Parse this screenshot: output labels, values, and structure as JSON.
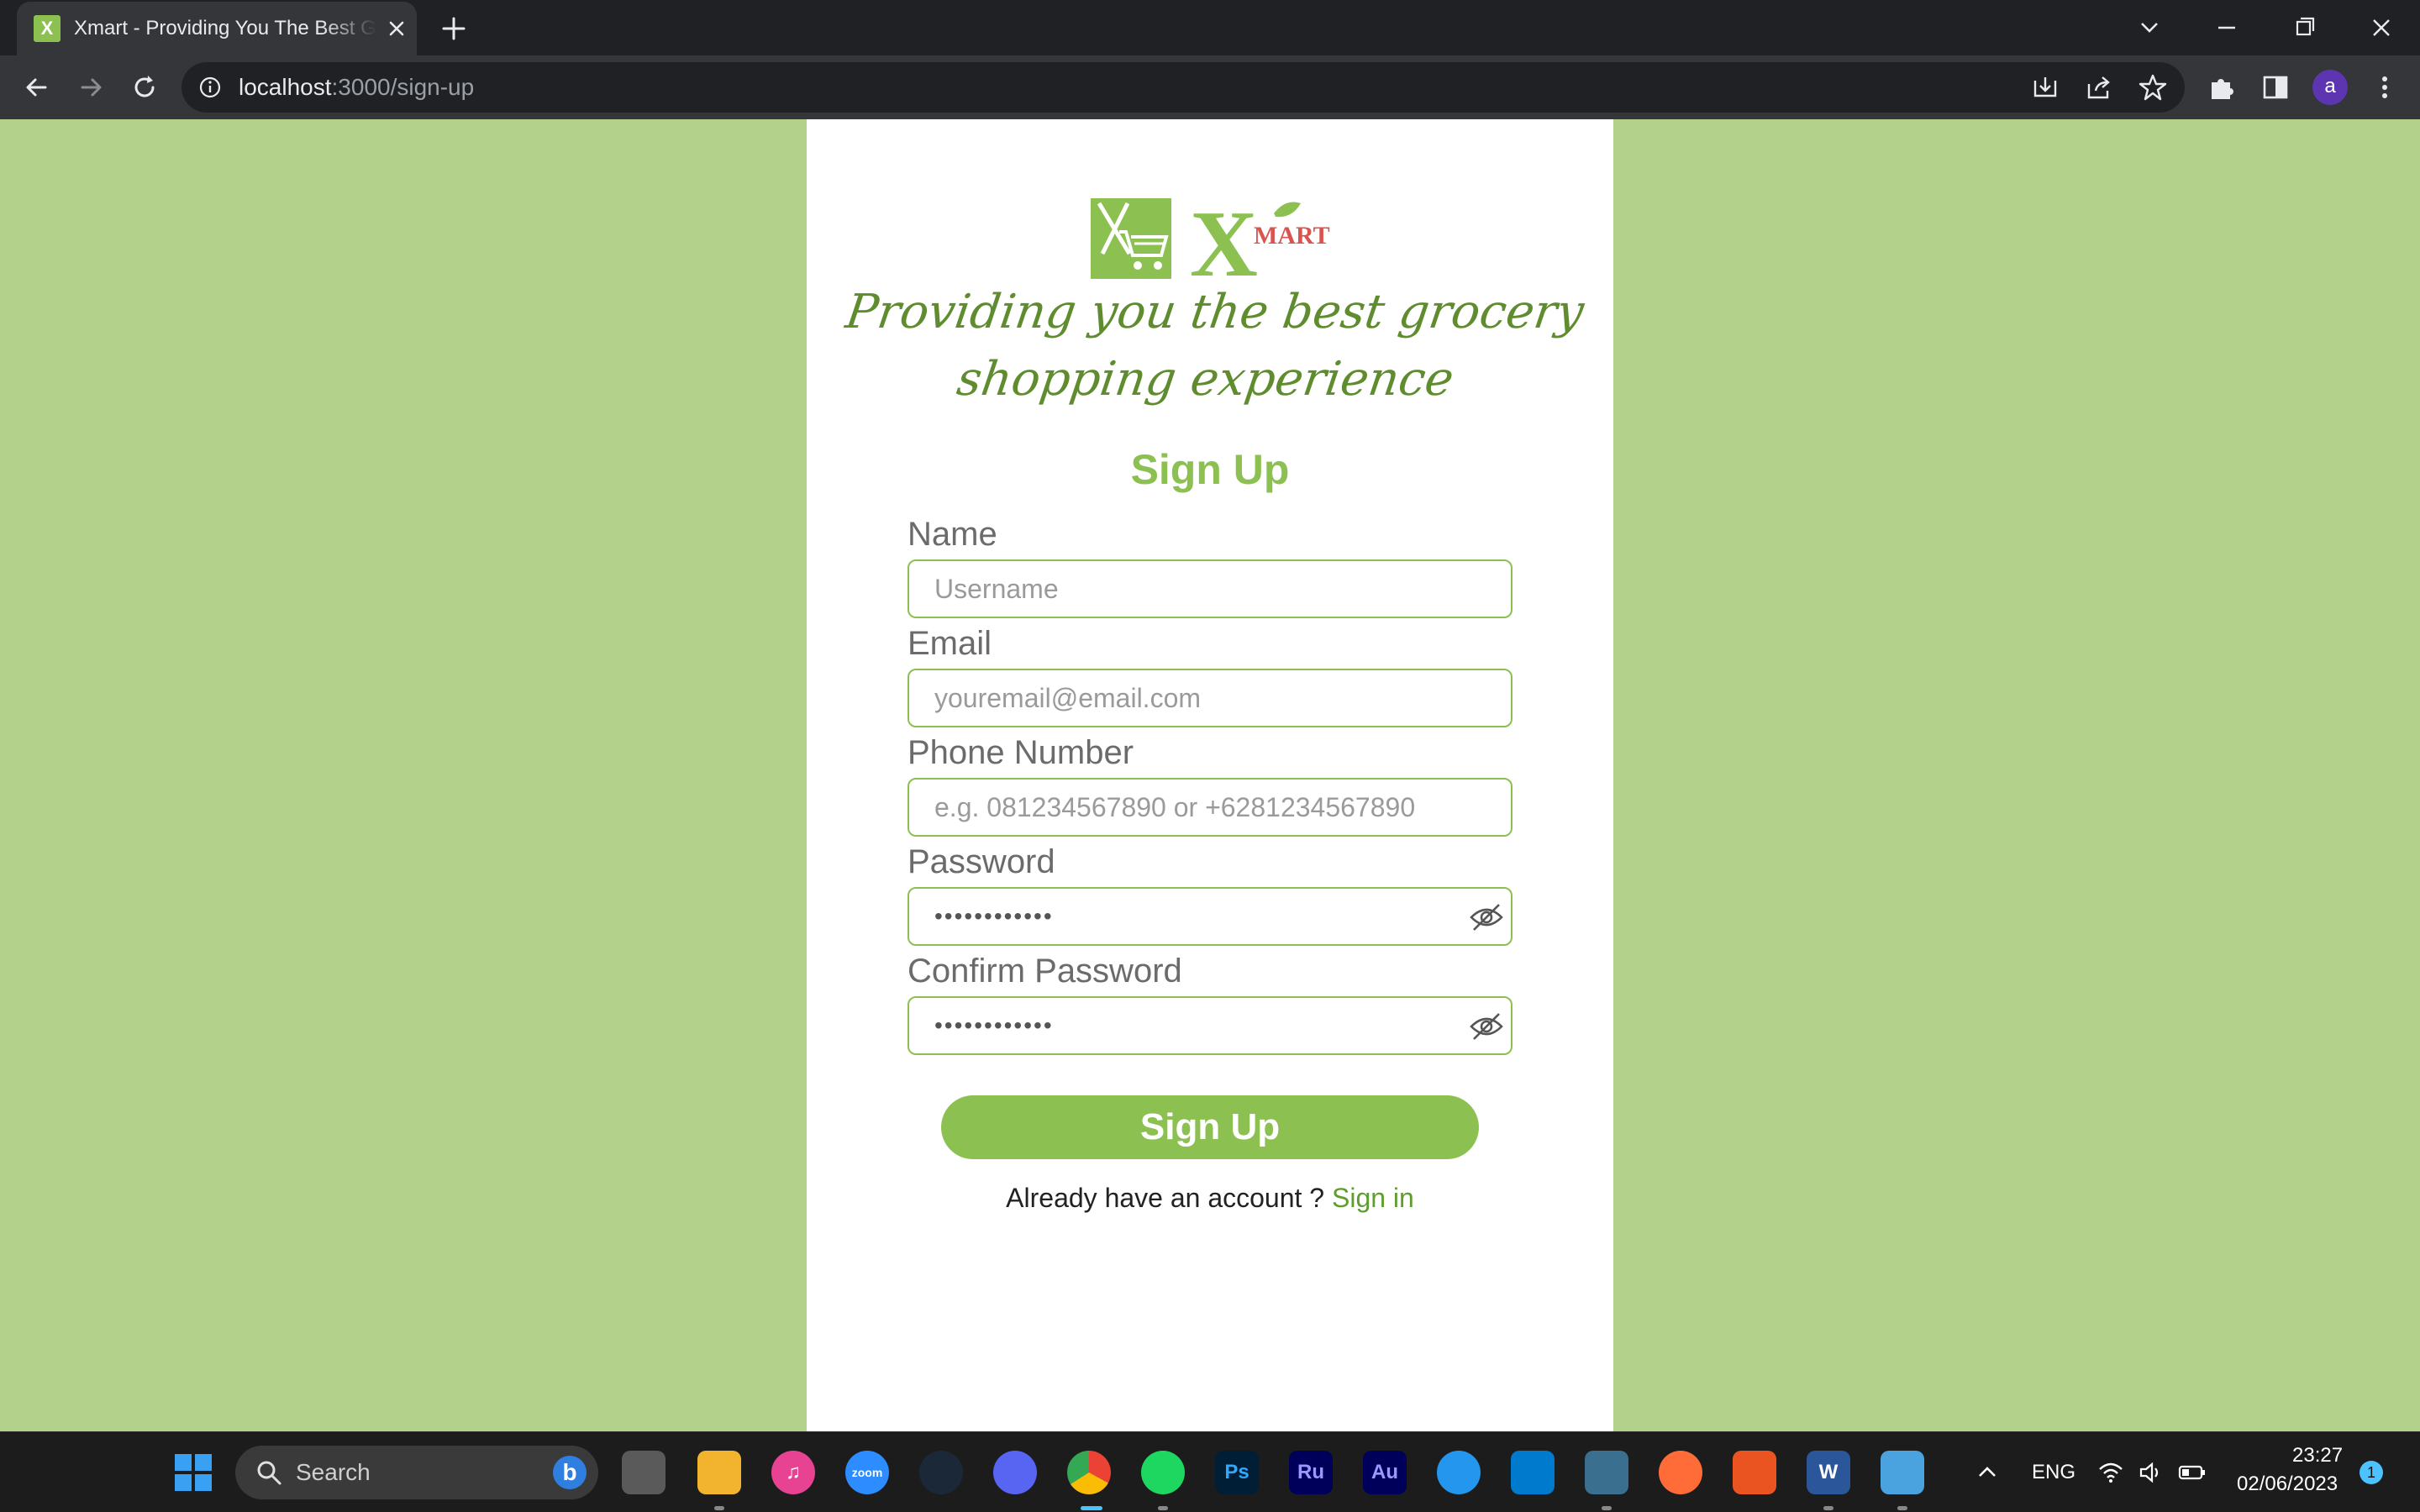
{
  "browser": {
    "tab_title": "Xmart - Providing You The Best Grocery Shopping Experience",
    "tab_favicon_text": "X",
    "url_host": "localhost",
    "url_path": ":3000/sign-up",
    "profile_initial": "a"
  },
  "page": {
    "logo_text": "MART",
    "logo_letter": "X",
    "tagline_line1": "Providing you the best grocery",
    "tagline_line2": "shopping experience",
    "heading": "Sign Up",
    "fields": {
      "name": {
        "label": "Name",
        "placeholder": "Username"
      },
      "email": {
        "label": "Email",
        "placeholder": "youremail@email.com"
      },
      "phone": {
        "label": "Phone Number",
        "placeholder": "e.g. 081234567890 or +6281234567890"
      },
      "password": {
        "label": "Password",
        "value": "••••••••••••"
      },
      "confirm_password": {
        "label": "Confirm Password",
        "value": "••••••••••••"
      }
    },
    "submit_label": "Sign Up",
    "signin_prompt": "Already have an account ?",
    "signin_link": "Sign in"
  },
  "taskbar": {
    "search_label": "Search",
    "apps": [
      "file-explorer",
      "itunes",
      "zoom",
      "steam",
      "discord",
      "chrome",
      "spotify",
      "photoshop",
      "premiere-rush",
      "audition",
      "docker",
      "vscode",
      "mysql-workbench",
      "postman",
      "ubuntu",
      "word",
      "photos"
    ],
    "zoom_label": "zoom",
    "ps_label": "Ps",
    "ru_label": "Ru",
    "au_label": "Au",
    "word_label": "W",
    "language": "ENG",
    "time": "23:27",
    "date": "02/06/2023",
    "notification_count": "1"
  },
  "colors": {
    "background": "#b3d18a",
    "brand_green": "#8cc152",
    "brand_red": "#d9534f"
  }
}
